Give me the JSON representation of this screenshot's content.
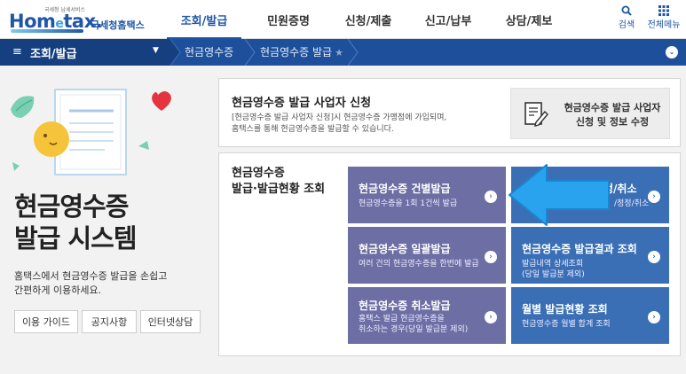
{
  "header": {
    "logo": {
      "small_text": "국세청 납세서비스",
      "word_a": "Hom",
      "word_e": "e",
      "word_b": "tax.",
      "korean": "국세청홈택스"
    },
    "nav": [
      {
        "label": "조회/발급",
        "active": true
      },
      {
        "label": "민원증명",
        "active": false
      },
      {
        "label": "신청/제출",
        "active": false
      },
      {
        "label": "신고/납부",
        "active": false
      },
      {
        "label": "상담/제보",
        "active": false
      }
    ],
    "search_label": "검색",
    "all_menu_label": "전체메뉴",
    "search_icon": "search-icon",
    "menu_icon": "grid-icon"
  },
  "breadcrumb": {
    "menu_label": "조회/발급",
    "items": [
      "현금영수증",
      "현금영수증 발급"
    ],
    "favorite_icon": "star-icon"
  },
  "hero": {
    "title_line1": "현금영수증",
    "title_line2": "발급 시스템",
    "desc_line1": "홈택스에서 현금영수증 발급을 손쉽고",
    "desc_line2": "간편하게 이용하세요.",
    "buttons": [
      "이용 가이드",
      "공지사항",
      "인터넷상담"
    ]
  },
  "apply_panel": {
    "title": "현금영수증 발급 사업자 신청",
    "desc_line1": "[현금영수증 발급 사업자 신청]시 현금영수증 가맹점에 가입되며,",
    "desc_line2": "홈택스를 통해 현금영수증을 발급할 수 있습니다.",
    "button_line1": "현금영수증 발급 사업자",
    "button_line2": "신청 및 정보 수정"
  },
  "issue_panel": {
    "title_line1": "현금영수증",
    "title_line2": "발급·발급현황 조회",
    "tiles": [
      {
        "title": "현금영수증 건별발급",
        "sub1": "현금영수증을 1회 1건씩 발급",
        "sub2": ""
      },
      {
        "title": "정/취소",
        "sub1": "/정정/취소",
        "sub2": ""
      },
      {
        "title": "현금영수증 일괄발급",
        "sub1": "여러 건의 현금영수증을 한번에 발급",
        "sub2": ""
      },
      {
        "title": "현금영수증 발급결과 조회",
        "sub1": "발급내역 상세조회",
        "sub2": "(당일 발급분 제외)"
      },
      {
        "title": "현금영수증 취소발급",
        "sub1": "홈택스 발급 현금영수증을",
        "sub2": "취소하는 경우(당일 발급분 제외)"
      },
      {
        "title": "월별 발급현황 조회",
        "sub1": "현금영수증 월별 합계 조회",
        "sub2": ""
      }
    ]
  },
  "colors": {
    "brand_blue": "#1f56a6",
    "breadcrumb_bar": "#1e4f9a",
    "tile_purple": "#6d6ea4",
    "tile_blue": "#3a6fb6",
    "arrow_blue": "#2aa3ee"
  }
}
